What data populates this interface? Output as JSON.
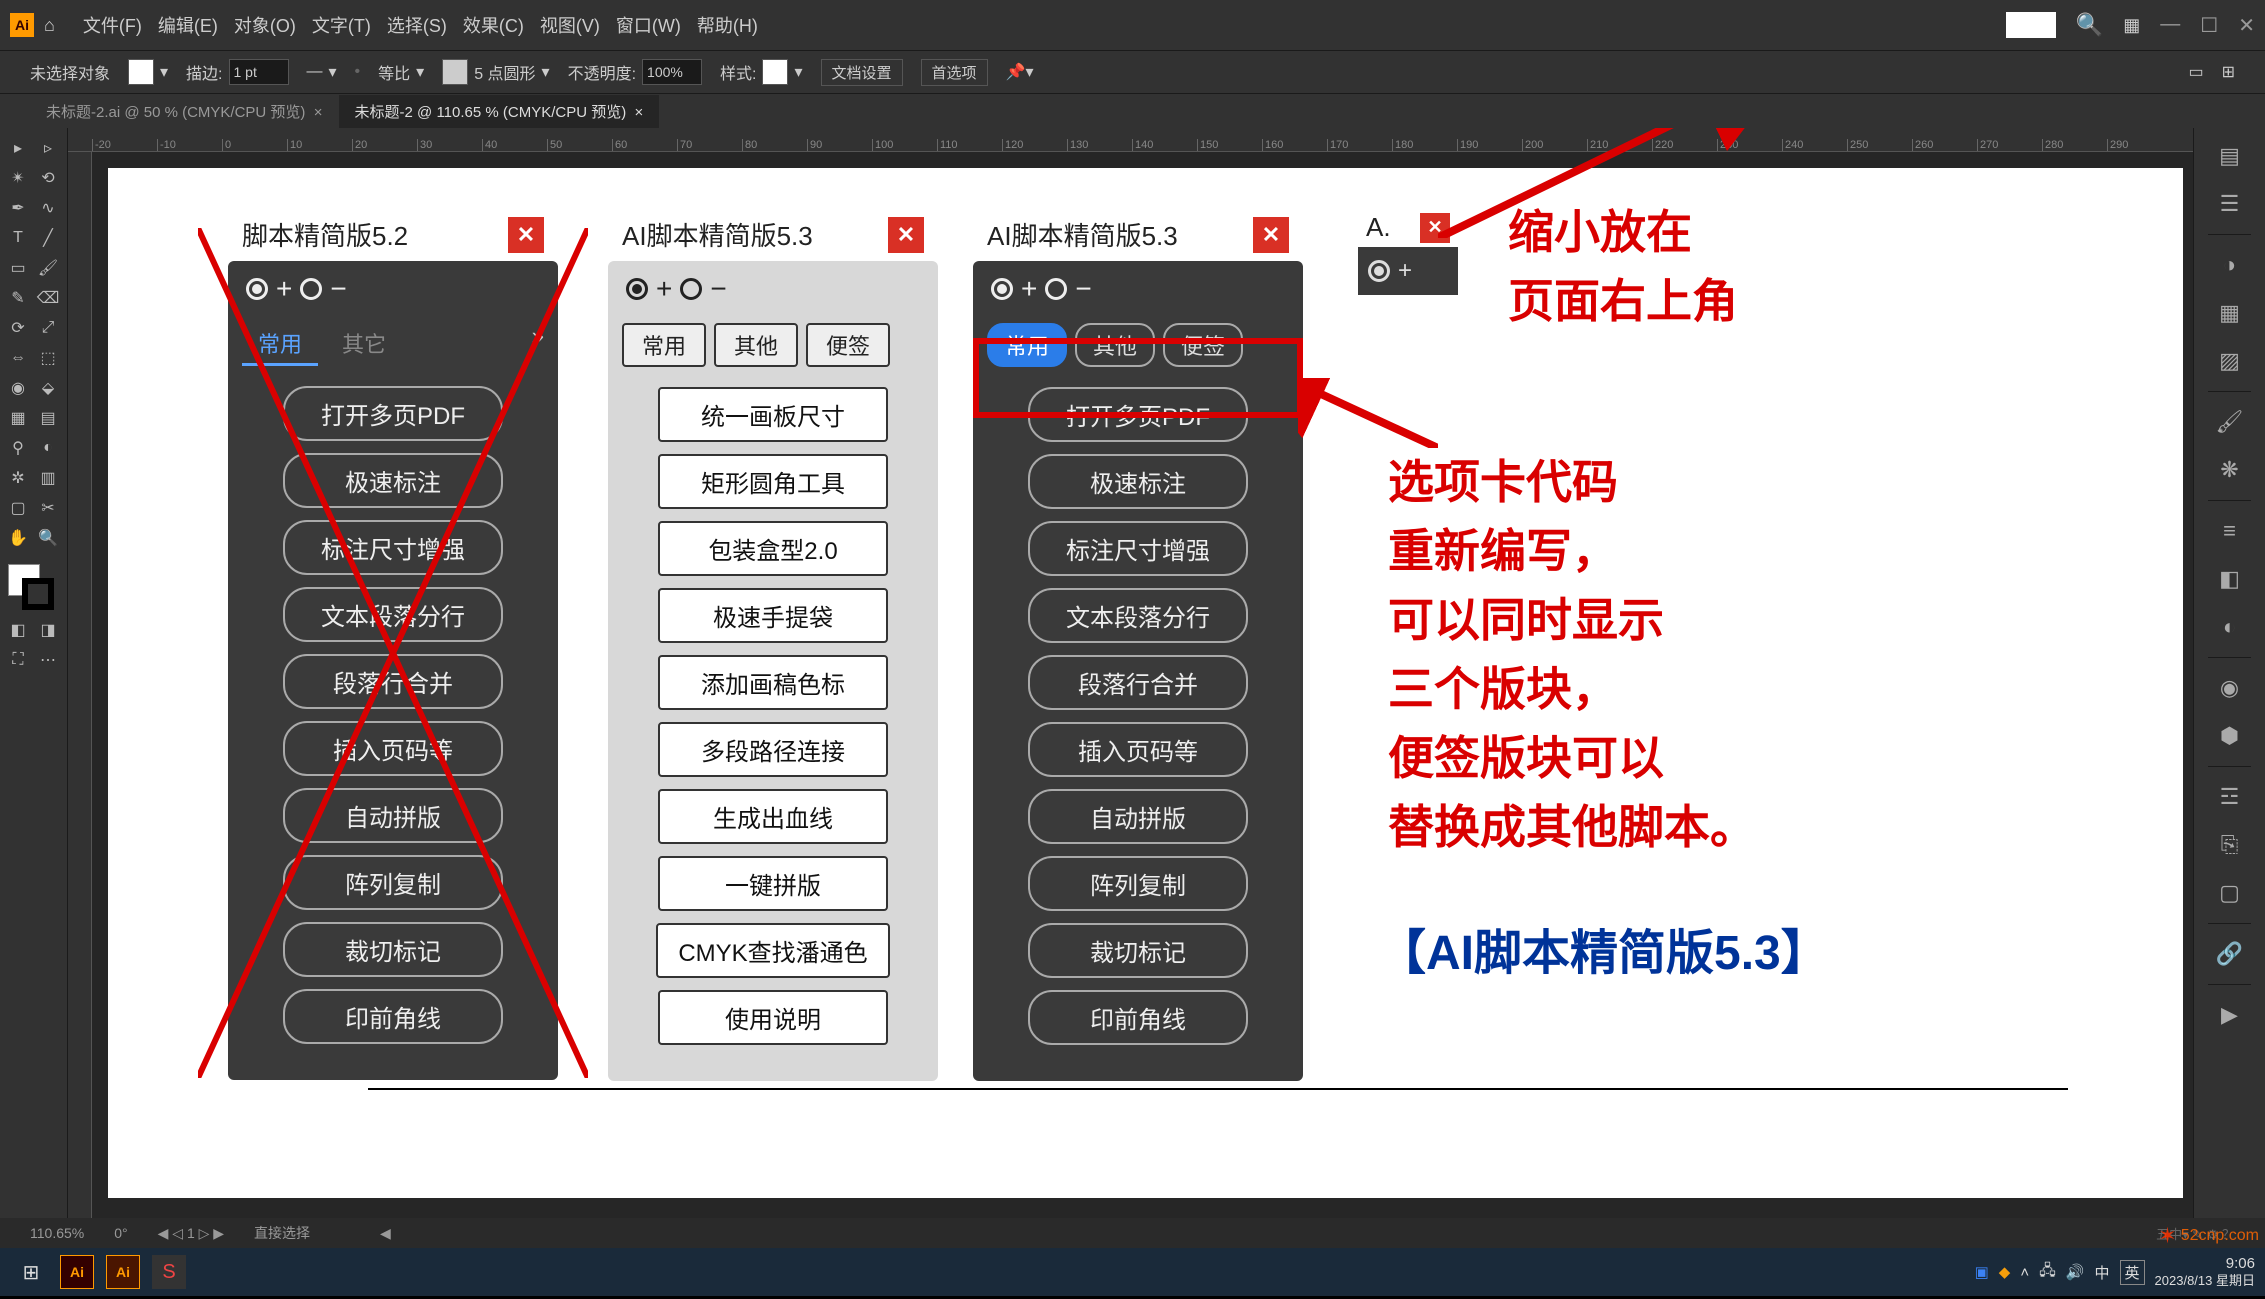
{
  "menubar": {
    "items": [
      "文件(F)",
      "编辑(E)",
      "对象(O)",
      "文字(T)",
      "选择(S)",
      "效果(C)",
      "视图(V)",
      "窗口(W)",
      "帮助(H)"
    ]
  },
  "options": {
    "no_selection": "未选择对象",
    "stroke_label": "描边:",
    "stroke_value": "1 pt",
    "uniform": "等比",
    "brush_label": "5 点圆形",
    "opacity_label": "不透明度:",
    "opacity_value": "100%",
    "style_label": "样式:",
    "doc_setup": "文档设置",
    "prefs": "首选项"
  },
  "tabs": {
    "t1": "未标题-2.ai @ 50 % (CMYK/CPU 预览)",
    "t2": "未标题-2 @ 110.65 % (CMYK/CPU 预览)"
  },
  "ruler_marks": [
    "-20",
    "-10",
    "0",
    "10",
    "20",
    "30",
    "40",
    "50",
    "60",
    "70",
    "80",
    "90",
    "100",
    "110",
    "120",
    "130",
    "140",
    "150",
    "160",
    "170",
    "180",
    "190",
    "200",
    "210",
    "220",
    "230",
    "240",
    "250",
    "260",
    "270",
    "280",
    "290"
  ],
  "panel52": {
    "title": "脚本精简版5.2",
    "tabs": [
      "常用",
      "其它"
    ],
    "buttons": [
      "打开多页PDF",
      "极速标注",
      "标注尺寸增强",
      "文本段落分行",
      "段落行合并",
      "插入页码等",
      "自动拼版",
      "阵列复制",
      "裁切标记",
      "印前角线"
    ]
  },
  "panel53_light": {
    "title": "AI脚本精简版5.3",
    "tabs": [
      "常用",
      "其他",
      "便签"
    ],
    "buttons": [
      "统一画板尺寸",
      "矩形圆角工具",
      "包装盒型2.0",
      "极速手提袋",
      "添加画稿色标",
      "多段路径连接",
      "生成出血线",
      "一键拼版",
      "CMYK查找潘通色",
      "使用说明"
    ]
  },
  "panel53_dark": {
    "title": "AI脚本精简版5.3",
    "tabs": [
      "常用",
      "其他",
      "便签"
    ],
    "buttons": [
      "打开多页PDF",
      "极速标注",
      "标注尺寸增强",
      "文本段落分行",
      "段落行合并",
      "插入页码等",
      "自动拼版",
      "阵列复制",
      "裁切标记",
      "印前角线"
    ]
  },
  "mini": {
    "title": "A."
  },
  "annotations": {
    "top1": "缩小放在",
    "top2": "页面右上角",
    "body": "选项卡代码\n重新编写，\n可以同时显示\n三个版块，\n便签版块可以\n替换成其他脚本。",
    "bottom": "【AI脚本精简版5.3】"
  },
  "status": {
    "zoom": "110.65%",
    "rotate": "0°",
    "artboard": "1",
    "tool": "直接选择"
  },
  "taskbar": {
    "time": "9:06",
    "date": "2023/8/13 星期日",
    "ime_indicator": "五中▾",
    "lang": "英",
    "extra": "中"
  },
  "watermark": "52cnp.com"
}
